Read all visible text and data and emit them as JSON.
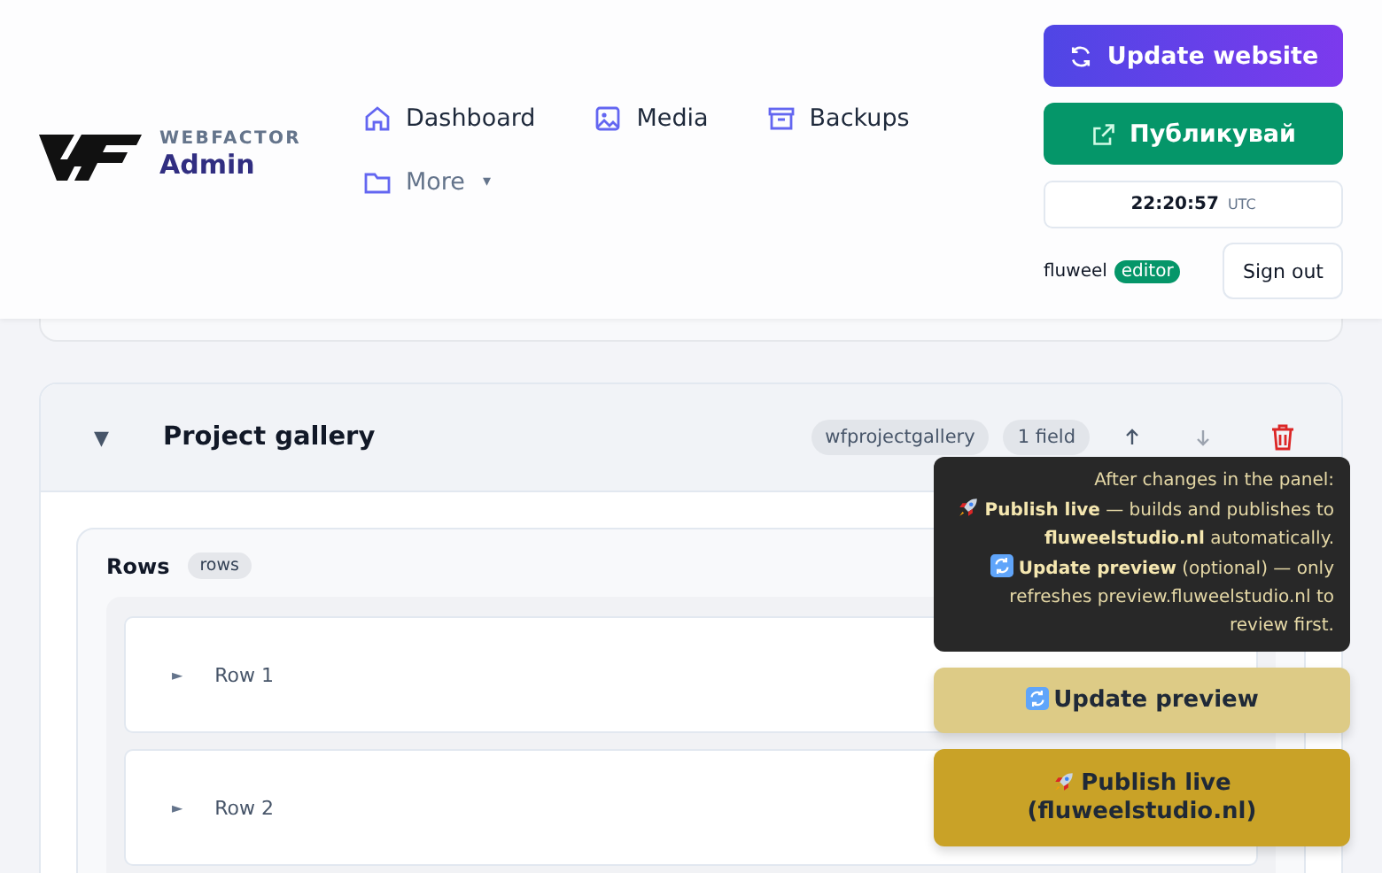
{
  "brand": {
    "overline": "WEBFACTOR",
    "title": "Admin"
  },
  "nav": [
    {
      "label": "Dashboard"
    },
    {
      "label": "Media"
    },
    {
      "label": "Backups"
    },
    {
      "label": "More",
      "caret": "▾"
    }
  ],
  "actions": {
    "update": "Update website",
    "publish": "Публикувай",
    "time": "22:20:57",
    "tz": "UTC",
    "user": "fluweel",
    "role": "editor",
    "signout": "Sign out"
  },
  "section": {
    "toggle": "▼",
    "title": "Project gallery",
    "tags": [
      "wfprojectgallery",
      "1 field"
    ],
    "field": {
      "label": "Rows",
      "tag": "rows",
      "rows": [
        {
          "toggle": "►",
          "label": "Row 1"
        },
        {
          "toggle": "►",
          "label": "Row 2"
        }
      ]
    }
  },
  "tooltip": [
    {
      "kind": "heading",
      "text": "After changes in the panel:"
    },
    {
      "kind": "live",
      "text": "**Publish live** — builds and publishes to **fluweelstudio.nl** automatically."
    },
    {
      "kind": "preview",
      "text": "**Update preview** (optional) — only refreshes preview.fluweelstudio.nl to review first."
    }
  ],
  "floating": [
    {
      "kind": "preview",
      "label": "Update preview"
    },
    {
      "kind": "live",
      "label": "Publish live\n(fluweelstudio.nl)"
    }
  ]
}
